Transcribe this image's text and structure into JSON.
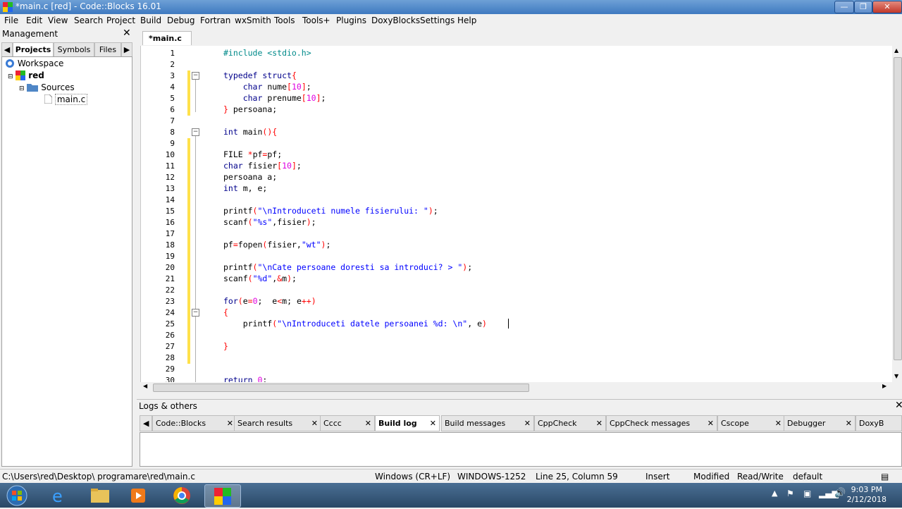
{
  "window": {
    "title": "*main.c [red] - Code::Blocks 16.01"
  },
  "menu": [
    "File",
    "Edit",
    "View",
    "Search",
    "Project",
    "Build",
    "Debug",
    "Fortran",
    "wxSmith",
    "Tools",
    "Tools+",
    "Plugins",
    "DoxyBlocks",
    "Settings",
    "Help"
  ],
  "management": {
    "title": "Management",
    "tabs": [
      "Projects",
      "Symbols",
      "Files"
    ],
    "tree": {
      "workspace": "Workspace",
      "project": "red",
      "folder": "Sources",
      "file": "main.c"
    }
  },
  "editor": {
    "tab": "*main.c",
    "lines": [
      {
        "n": "1",
        "html": "<span class='pp'>#include &lt;stdio.h&gt;</span>"
      },
      {
        "n": "2",
        "html": ""
      },
      {
        "n": "3",
        "html": "<span class='kw'>typedef struct</span><span class='op'>{</span>"
      },
      {
        "n": "4",
        "html": "    <span class='kw'>char</span> nume<span class='op'>[</span><span class='num'>10</span><span class='op'>]</span>;"
      },
      {
        "n": "5",
        "html": "    <span class='kw'>char</span> prenume<span class='op'>[</span><span class='num'>10</span><span class='op'>]</span>;"
      },
      {
        "n": "6",
        "html": "<span class='op'>}</span> persoana;"
      },
      {
        "n": "7",
        "html": ""
      },
      {
        "n": "8",
        "html": "<span class='kw'>int</span> main<span class='op'>(){</span>"
      },
      {
        "n": "9",
        "html": ""
      },
      {
        "n": "10",
        "html": "FILE <span class='op'>*</span>pf<span class='op'>=</span>pf;"
      },
      {
        "n": "11",
        "html": "<span class='kw'>char</span> fisier<span class='op'>[</span><span class='num'>10</span><span class='op'>]</span>;"
      },
      {
        "n": "12",
        "html": "persoana a;"
      },
      {
        "n": "13",
        "html": "<span class='kw'>int</span> m, e;"
      },
      {
        "n": "14",
        "html": ""
      },
      {
        "n": "15",
        "html": "printf<span class='op'>(</span><span class='str'>\"\\nIntroduceti numele fisierului: \"</span><span class='op'>)</span>;"
      },
      {
        "n": "16",
        "html": "scanf<span class='op'>(</span><span class='str'>\"%s\"</span>,fisier<span class='op'>)</span>;"
      },
      {
        "n": "17",
        "html": ""
      },
      {
        "n": "18",
        "html": "pf<span class='op'>=</span>fopen<span class='op'>(</span>fisier,<span class='str'>\"wt\"</span><span class='op'>)</span>;"
      },
      {
        "n": "19",
        "html": ""
      },
      {
        "n": "20",
        "html": "printf<span class='op'>(</span><span class='str'>\"\\nCate persoane doresti sa introduci? &gt; \"</span><span class='op'>)</span>;"
      },
      {
        "n": "21",
        "html": "scanf<span class='op'>(</span><span class='str'>\"%d\"</span>,<span class='op'>&amp;</span>m<span class='op'>)</span>;"
      },
      {
        "n": "22",
        "html": ""
      },
      {
        "n": "23",
        "html": "<span class='kw'>for</span><span class='op'>(</span>e<span class='op'>=</span><span class='num'>0</span>;  e<span class='op'>&lt;</span>m; e<span class='op'>++)</span>"
      },
      {
        "n": "24",
        "html": "<span class='op'>{</span>"
      },
      {
        "n": "25",
        "html": "    printf<span class='op'>(</span><span class='str'>\"\\nIntroduceti datele persoanei %d: \\n\"</span>, e<span class='op'>)</span>"
      },
      {
        "n": "26",
        "html": ""
      },
      {
        "n": "27",
        "html": "<span class='op'>}</span>"
      },
      {
        "n": "28",
        "html": ""
      },
      {
        "n": "29",
        "html": ""
      },
      {
        "n": "30",
        "html": "<span class='kw'>return</span> <span class='num'>0</span>;"
      }
    ]
  },
  "logs": {
    "title": "Logs & others",
    "tabs": [
      "Code::Blocks",
      "Search results",
      "Cccc",
      "Build log",
      "Build messages",
      "CppCheck",
      "CppCheck messages",
      "Cscope",
      "Debugger",
      "DoxyB"
    ],
    "active_tab": "Build log"
  },
  "status": {
    "path": "C:\\Users\\red\\Desktop\\ programare\\red\\main.c",
    "eol": "Windows (CR+LF)",
    "encoding": "WINDOWS-1252",
    "position": "Line 25, Column 59",
    "mode": "Insert",
    "modified": "Modified",
    "rw": "Read/Write",
    "profile": "default"
  },
  "taskbar": {
    "time": "9:03 PM",
    "date": "2/12/2018"
  }
}
